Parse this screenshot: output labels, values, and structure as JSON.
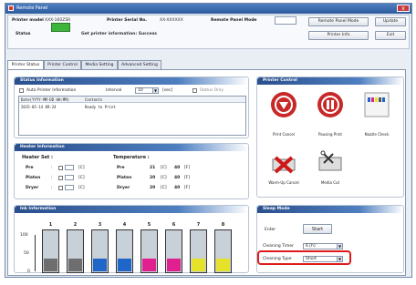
{
  "window": {
    "title": "Remote Panel",
    "close_glyph": "x"
  },
  "header": {
    "printer_model_label": "Printer model",
    "printer_model_value": "XXX-160ZSR",
    "serial_label": "Printer Serial No.",
    "serial_value": "XX-XXXXXX",
    "remote_mode_label": "Remote Panel Mode",
    "status_label": "Status",
    "status_text": "Get printer information: Success",
    "status_color": "#3db43a",
    "btn_remote_panel_mode": "Remote Panel Mode",
    "btn_update": "Update",
    "btn_printer_info": "Printer Info",
    "btn_exit": "Exit"
  },
  "tabs": [
    {
      "label": "Printer Status"
    },
    {
      "label": "Printer Control"
    },
    {
      "label": "Media Setting"
    },
    {
      "label": "Advanced Setting"
    }
  ],
  "status_info": {
    "title": "Status Information",
    "auto_label": "Auto Printer Information",
    "interval_label": "Interval",
    "interval_value": "10",
    "interval_unit": "[sec]",
    "status_only_label": "Status Only",
    "col_date": "Date(YYYY-MM-DD HH:MM)",
    "col_contents": "Contents",
    "row_date": "2015-05-14 09:24",
    "row_contents": "Ready to Print"
  },
  "heater": {
    "title": "Heater Information",
    "set_label": "Heater Set :",
    "temp_label": "Temperature :",
    "rows": [
      {
        "name": "Pre",
        "temp": "21",
        "target": "40"
      },
      {
        "name": "Platen",
        "temp": "20",
        "target": "40"
      },
      {
        "name": "Dryer",
        "temp": "20",
        "target": "40"
      }
    ],
    "unit_c": "[C]",
    "unit_f": "[F]",
    "colon": ":"
  },
  "ink": {
    "title": "Ink Information",
    "slots": [
      "1",
      "2",
      "3",
      "4",
      "5",
      "6",
      "7",
      "8"
    ],
    "levels": [
      0.3,
      0.3,
      0.3,
      0.3,
      0.3,
      0.3,
      0.3,
      0.3
    ],
    "colors": [
      "#6e6e6e",
      "#6e6e6e",
      "#1f66c9",
      "#1f66c9",
      "#e0208e",
      "#e0208e",
      "#e6e22a",
      "#e6e22a"
    ],
    "axis": [
      "100",
      "50",
      "0"
    ]
  },
  "printer_control": {
    "title": "Printer Control",
    "print_cancel": "Print Cancel",
    "pausing_print": "Pausing Print",
    "nozzle_check": "Nozzle Check",
    "warmup_cancel": "Warm-Up Cancel",
    "media_cut": "Media Cut"
  },
  "sleep_mode": {
    "title": "Sleep Mode",
    "enter_label": "Enter",
    "start_label": "Start",
    "cleaning_timer_label": "Cleaning Timer",
    "cleaning_timer_value": "6 [h]",
    "cleaning_type_label": "Cleaning Type",
    "cleaning_type_value": "Short"
  }
}
